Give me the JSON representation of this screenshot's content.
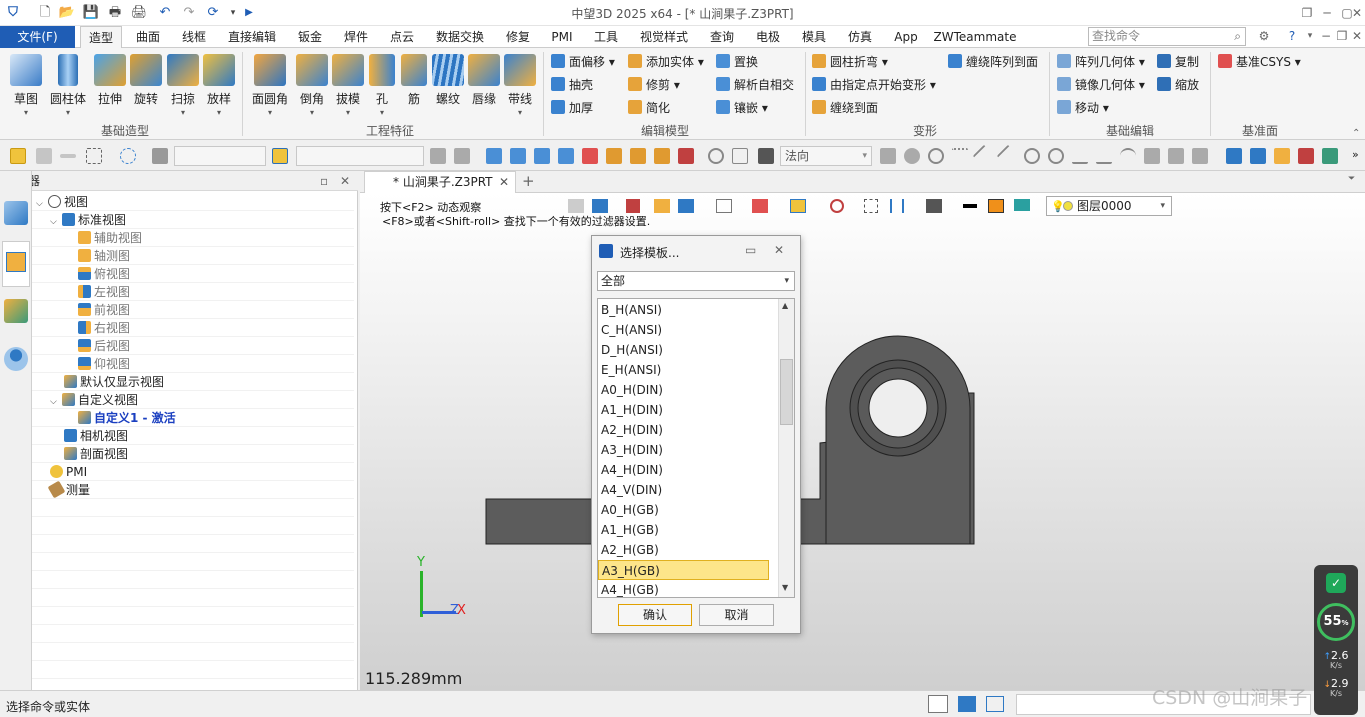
{
  "window": {
    "title": "中望3D 2025 x64 - [* 山涧果子.Z3PRT]"
  },
  "menu": {
    "file": "文件(F)",
    "tabs": [
      "造型",
      "曲面",
      "线框",
      "直接编辑",
      "钣金",
      "焊件",
      "点云",
      "数据交换",
      "修复",
      "PMI",
      "工具",
      "视觉样式",
      "查询",
      "电极",
      "模具",
      "仿真",
      "App",
      "ZWTeammate"
    ],
    "active_tab": "造型",
    "search_placeholder": "查找命令"
  },
  "ribbon": {
    "basic_shape": {
      "label": "基础造型",
      "buttons": [
        "草图",
        "圆柱体",
        "拉伸",
        "旋转",
        "扫掠",
        "放样"
      ]
    },
    "eng_feature": {
      "label": "工程特征",
      "buttons": [
        "面圆角",
        "倒角",
        "拔模",
        "孔",
        "筋",
        "螺纹",
        "唇缘",
        "带线"
      ]
    },
    "edit_model": {
      "label": "编辑模型",
      "items": [
        "面偏移",
        "添加实体",
        "置换",
        "抽壳",
        "修剪",
        "解析自相交",
        "加厚",
        "简化",
        "镶嵌"
      ]
    },
    "deform": {
      "label": "变形",
      "items": [
        "圆柱折弯",
        "缠绕阵列到面",
        "由指定点开始变形",
        "缠绕到面"
      ]
    },
    "basic_edit": {
      "label": "基础编辑",
      "items": [
        "阵列几何体",
        "复制",
        "镜像几何体",
        "缩放",
        "移动"
      ]
    },
    "datum": {
      "label": "基准面",
      "items": [
        "基准CSYS"
      ]
    }
  },
  "toolbar2": {
    "direction_combo": "法向"
  },
  "manager": {
    "title": "管理器",
    "tree": [
      {
        "label": "视图"
      },
      {
        "label": "标准视图"
      },
      {
        "label": "辅助视图"
      },
      {
        "label": "轴测图"
      },
      {
        "label": "俯视图"
      },
      {
        "label": "左视图"
      },
      {
        "label": "前视图"
      },
      {
        "label": "右视图"
      },
      {
        "label": "后视图"
      },
      {
        "label": "仰视图"
      },
      {
        "label": "默认仅显示视图"
      },
      {
        "label": "自定义视图"
      },
      {
        "label": "自定义1 - 激活"
      },
      {
        "label": "相机视图"
      },
      {
        "label": "剖面视图"
      },
      {
        "label": "PMI"
      },
      {
        "label": "测量"
      }
    ]
  },
  "document": {
    "tab": "* 山涧果子.Z3PRT",
    "hint1": "按下<F2> 动态观察",
    "hint2": "<F8>或者<Shift-roll> 查找下一个有效的过滤器设置.",
    "layer": "图层0000",
    "measure": "115.289mm",
    "axis_y": "Y",
    "axis_z": "Z",
    "axis_x": "X"
  },
  "dialog": {
    "title": "选择模板...",
    "filter": "全部",
    "items": [
      "B_H(ANSI)",
      "C_H(ANSI)",
      "D_H(ANSI)",
      "E_H(ANSI)",
      "A0_H(DIN)",
      "A1_H(DIN)",
      "A2_H(DIN)",
      "A3_H(DIN)",
      "A4_H(DIN)",
      "A4_V(DIN)",
      "A0_H(GB)",
      "A1_H(GB)",
      "A2_H(GB)",
      "A3_H(GB)",
      "A4_H(GB)"
    ],
    "selected": "A3_H(GB)",
    "ok": "确认",
    "cancel": "取消"
  },
  "status": {
    "text": "选择命令或实体",
    "watermark": "CSDN @山涧果子"
  },
  "hud": {
    "percent": "55",
    "percent_unit": "%",
    "up_value": "2.6",
    "up_unit": "K/s",
    "down_value": "2.9",
    "down_unit": "K/s"
  },
  "colors": {
    "accent": "#1f5db5",
    "selected_row": "#fde58a",
    "model_gray": "#5c5c5c"
  }
}
